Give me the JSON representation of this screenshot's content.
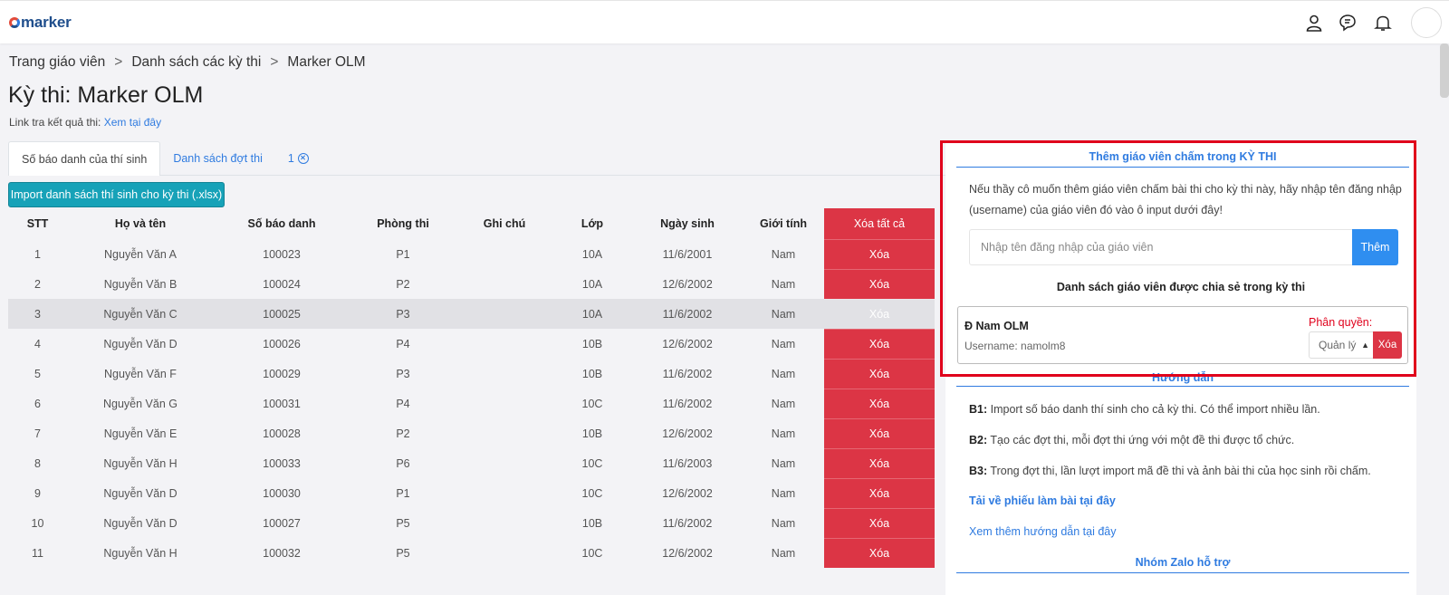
{
  "app": {
    "logo_text": "marker"
  },
  "breadcrumb": [
    "Trang giáo viên",
    "Danh sách các kỳ thi",
    "Marker OLM"
  ],
  "breadcrumb_sep": ">",
  "title": "Kỳ thi: Marker OLM",
  "result_link": {
    "label": "Link tra kết quả thi:",
    "link_text": "Xem tại đây"
  },
  "tabs": [
    {
      "label": "Số báo danh của thí sinh",
      "active": true
    },
    {
      "label": "Danh sách đợt thi",
      "active": false
    },
    {
      "label": "1",
      "active": false,
      "icon": "close-circle-icon"
    }
  ],
  "import_button": "Import danh sách thí sinh cho kỳ thi (.xlsx)",
  "table": {
    "headers": [
      "STT",
      "Họ và tên",
      "Số báo danh",
      "Phòng thi",
      "Ghi chú",
      "Lớp",
      "Ngày sinh",
      "Giới tính"
    ],
    "delete_all_label": "Xóa tất cả",
    "delete_label": "Xóa",
    "rows": [
      [
        "1",
        "Nguyễn Văn A",
        "100023",
        "P1",
        "",
        "10A",
        "11/6/2001",
        "Nam"
      ],
      [
        "2",
        "Nguyễn Văn B",
        "100024",
        "P2",
        "",
        "10A",
        "12/6/2002",
        "Nam"
      ],
      [
        "3",
        "Nguyễn Văn C",
        "100025",
        "P3",
        "",
        "10A",
        "11/6/2002",
        "Nam"
      ],
      [
        "4",
        "Nguyễn Văn D",
        "100026",
        "P4",
        "",
        "10B",
        "12/6/2002",
        "Nam"
      ],
      [
        "5",
        "Nguyễn Văn F",
        "100029",
        "P3",
        "",
        "10B",
        "11/6/2002",
        "Nam"
      ],
      [
        "6",
        "Nguyễn Văn G",
        "100031",
        "P4",
        "",
        "10C",
        "11/6/2002",
        "Nam"
      ],
      [
        "7",
        "Nguyễn Văn E",
        "100028",
        "P2",
        "",
        "10B",
        "12/6/2002",
        "Nam"
      ],
      [
        "8",
        "Nguyễn Văn H",
        "100033",
        "P6",
        "",
        "10C",
        "11/6/2003",
        "Nam"
      ],
      [
        "9",
        "Nguyễn Văn D",
        "100030",
        "P1",
        "",
        "10C",
        "12/6/2002",
        "Nam"
      ],
      [
        "10",
        "Nguyễn Văn D",
        "100027",
        "P5",
        "",
        "10B",
        "11/6/2002",
        "Nam"
      ],
      [
        "11",
        "Nguyễn Văn H",
        "100032",
        "P5",
        "",
        "10C",
        "12/6/2002",
        "Nam"
      ]
    ],
    "highlighted_row": 2
  },
  "side": {
    "add_teacher_heading": "Thêm giáo viên chấm trong KỲ THI",
    "instruction": "Nếu thầy cô muốn thêm giáo viên chấm bài thi cho kỳ thi này, hãy nhập tên đăng nhập (username) của giáo viên đó vào ô input dưới đây!",
    "input_placeholder": "Nhập tên đăng nhập của giáo viên",
    "add_button": "Thêm",
    "shared_list_title": "Danh sách giáo viên được chia sẻ trong kỳ thi",
    "teacher": {
      "name": "Đ Nam OLM",
      "username": "Username: namolm8",
      "permission_label": "Phân quyền:",
      "permission_value": "Quản lý",
      "delete_label": "Xóa"
    },
    "guide_heading": "Hướng dẫn",
    "guide_steps": [
      {
        "key": "B1:",
        "text": " Import số báo danh thí sinh cho cả kỳ thi. Có thể import nhiều lần."
      },
      {
        "key": "B2:",
        "text": " Tạo các đợt thi, mỗi đợt thi ứng với một đề thi được tổ chức."
      },
      {
        "key": "B3:",
        "text": " Trong đợt thi, lần lượt import mã đề thi và ảnh bài thi của học sinh rồi chấm."
      }
    ],
    "download_link": "Tải về phiếu làm bài tại đây",
    "more_guide_link": "Xem thêm hướng dẫn tại đây",
    "zalo_heading": "Nhóm Zalo hỗ trợ"
  },
  "colors": {
    "accent": "#2f7be0",
    "danger": "#dc3545",
    "info": "#17a2b8",
    "highlight": "#e0001b"
  }
}
